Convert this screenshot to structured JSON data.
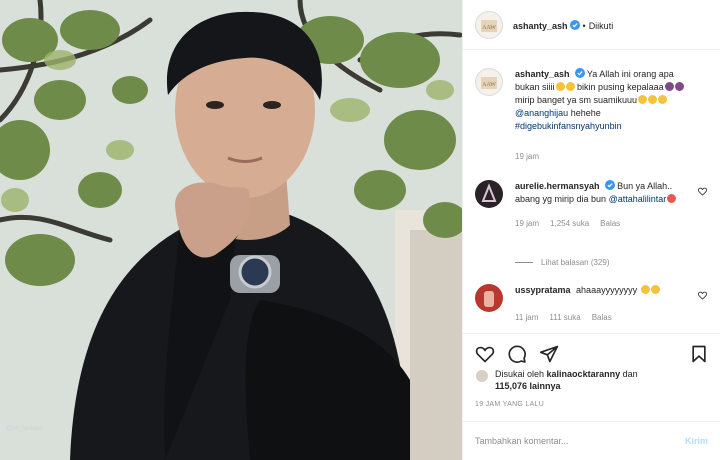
{
  "header": {
    "username": "ashanty_ash",
    "follow_status": "Diikuti",
    "dot": "•"
  },
  "comments": [
    {
      "username": "ashanty_ash",
      "text_1": "Ya Allah ini orang apa bukan siiii",
      "text_2": "bikin pusing kepalaaa",
      "text_3": "mirip banget ya sm suamikuuu",
      "mention": "@ananghijau",
      "text_4": "hehehe",
      "hashtag": "#digebukinfansnyahyunbin",
      "time": "19 jam"
    },
    {
      "username": "aurelie.hermansyah",
      "text": "Bun ya Allah.. abang yg mirip dia bun",
      "mention": "@attahalilintar",
      "time": "19 jam",
      "likes": "1,254 suka",
      "reply": "Balas",
      "view_replies": "Lihat balasan (329)"
    },
    {
      "username": "ussypratama",
      "text": "ahaaayyyyyyyy",
      "time": "11 jam",
      "likes": "111 suka",
      "reply": "Balas"
    }
  ],
  "likes": {
    "prefix": "Disukai oleh",
    "user": "kalinaocktaranny",
    "conj": "dan",
    "count": "115,076 lainnya"
  },
  "timestamp": "19 JAM YANG LALU",
  "comment_box": {
    "placeholder": "Tambahkan komentar...",
    "send_label": "Kirim"
  },
  "icons": [
    "heart-icon",
    "comment-icon",
    "share-icon",
    "bookmark-icon",
    "verified-icon"
  ],
  "colors": {
    "verified": "#3897f0",
    "link": "#00376b",
    "send_disabled": "#b2dffc",
    "muted": "#8e8e8e"
  }
}
